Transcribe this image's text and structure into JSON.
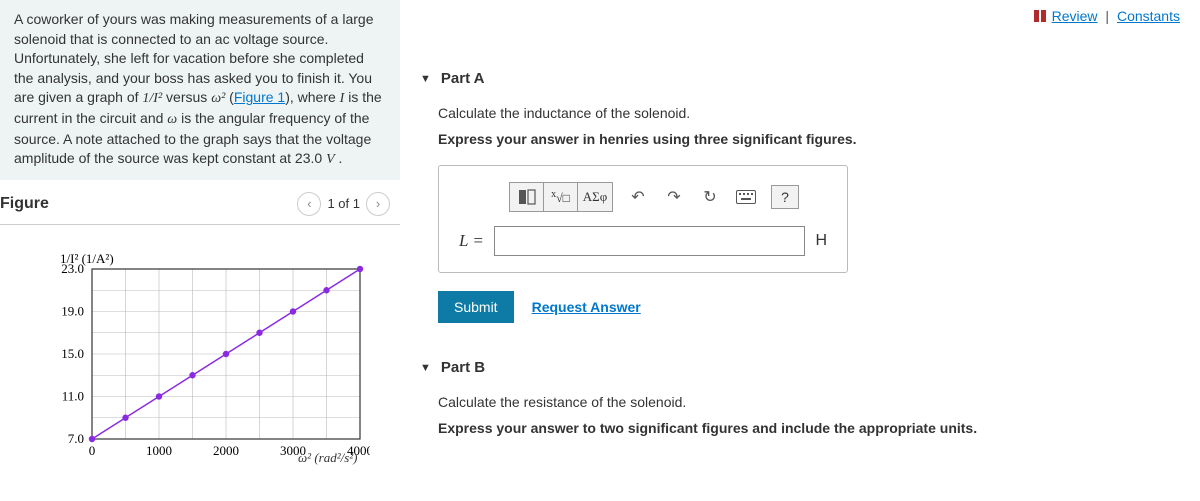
{
  "top": {
    "review": "Review",
    "constants": "Constants"
  },
  "problem": {
    "text1": "A coworker of yours was making measurements of a large solenoid that is connected to an ac voltage source. Unfortunately, she left for vacation before she completed the analysis, and your boss has asked you to finish it. You are given a graph of ",
    "expr1": "1/I²",
    "text2": " versus ",
    "expr2": "ω²",
    "text3": " (",
    "figlink": "Figure 1",
    "text4": "), where ",
    "expr3": "I",
    "text5": " is the current in the circuit and ",
    "expr4": "ω",
    "text6": " is the angular frequency of the source. A note attached to the graph says that the voltage amplitude of the source was kept constant at 23.0 ",
    "expr5": "V",
    "text7": " ."
  },
  "figure": {
    "title": "Figure",
    "counter": "1 of 1"
  },
  "chart_data": {
    "type": "scatter",
    "x": [
      0,
      500,
      1000,
      1500,
      2000,
      2500,
      3000,
      3500,
      4000
    ],
    "y": [
      7.0,
      9.0,
      11.0,
      13.0,
      15.0,
      17.0,
      19.0,
      21.0,
      23.0
    ],
    "xlabel": "ω² (rad²/s²)",
    "ylabel": "1/I² (1/A²)",
    "xticks": [
      0,
      1000,
      2000,
      3000,
      4000
    ],
    "yticks": [
      7.0,
      11.0,
      15.0,
      19.0,
      23.0
    ],
    "xlim": [
      0,
      4000
    ],
    "ylim": [
      7.0,
      23.0
    ],
    "line": true
  },
  "partA": {
    "title": "Part A",
    "prompt": "Calculate the inductance of the solenoid.",
    "instruct": "Express your answer in henries using three significant figures.",
    "var": "L =",
    "unit": "H",
    "submit": "Submit",
    "request": "Request Answer",
    "greek": "ΑΣφ",
    "help": "?"
  },
  "partB": {
    "title": "Part B",
    "prompt": "Calculate the resistance of the solenoid.",
    "instruct": "Express your answer to two significant figures and include the appropriate units."
  }
}
